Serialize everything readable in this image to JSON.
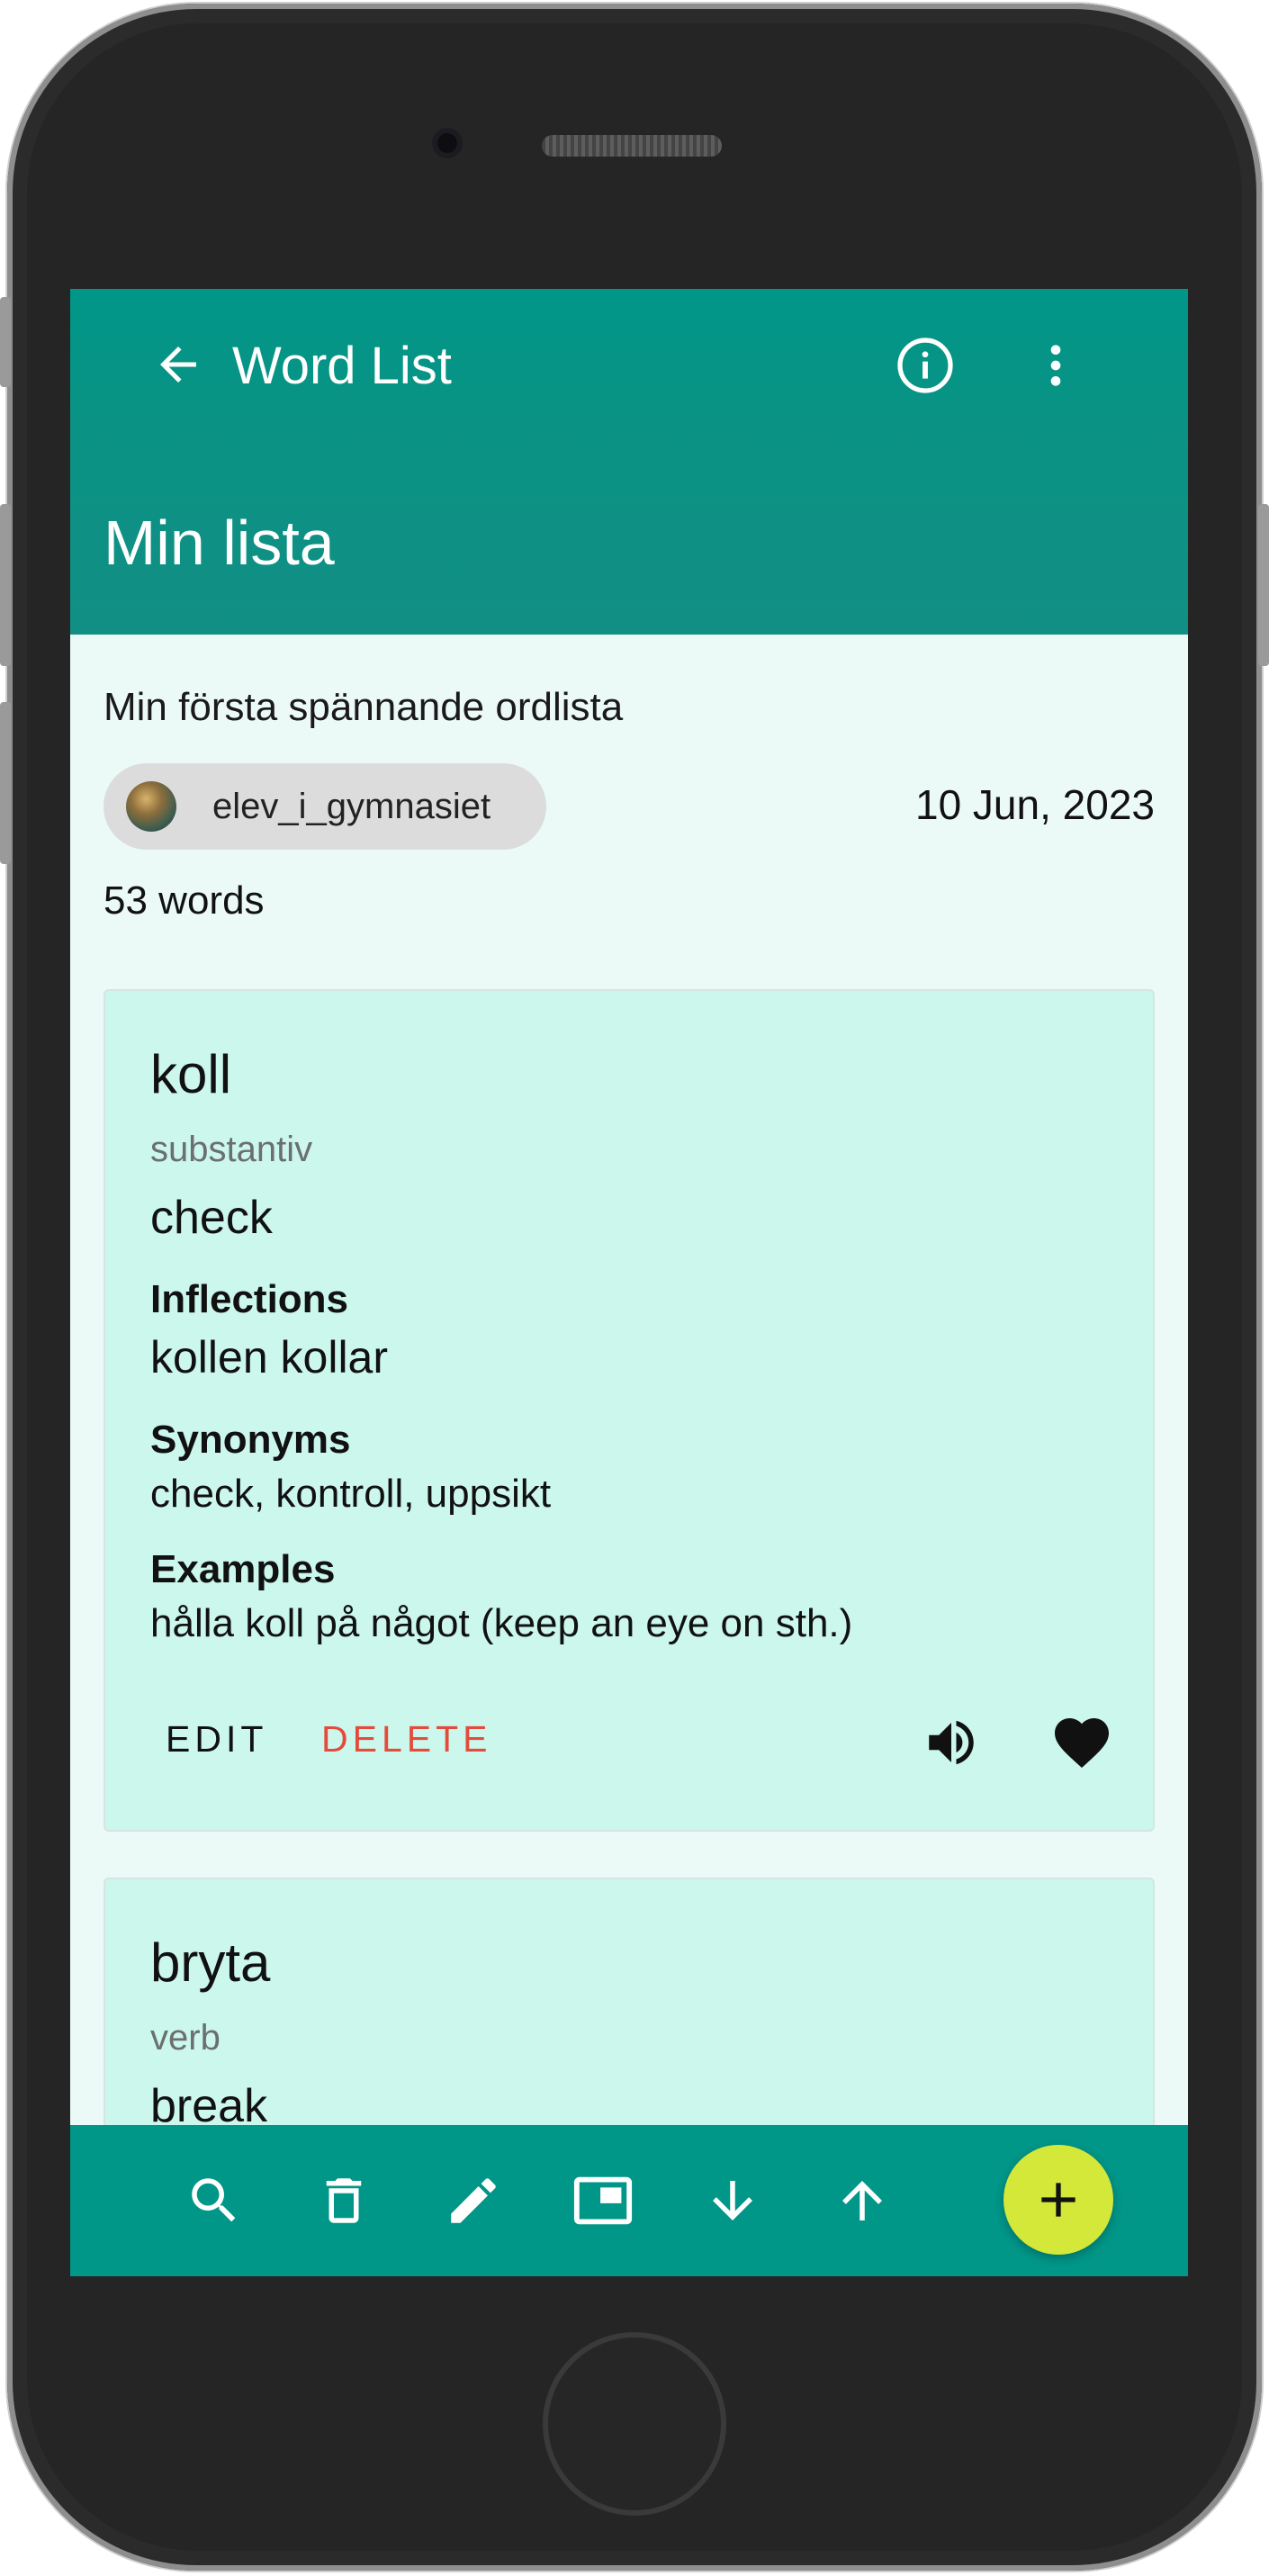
{
  "appbar": {
    "title": "Word List",
    "back_icon": "arrow-back-icon",
    "info_icon": "info-icon",
    "more_icon": "more-vert-icon"
  },
  "list": {
    "title": "Min lista",
    "description": "Min första spännande ordlista",
    "author": "elev_i_gymnasiet",
    "date": "10 Jun, 2023",
    "count": "53 words"
  },
  "words": [
    {
      "word": "koll",
      "pos": "substantiv",
      "translation": "check",
      "inflections_label": "Inflections",
      "inflections": "kollen kollar",
      "synonyms_label": "Synonyms",
      "synonyms": "check, kontroll, uppsikt",
      "examples_label": "Examples",
      "examples": "hålla koll på något (keep an eye on sth.)",
      "edit_label": "EDIT",
      "delete_label": "DELETE"
    },
    {
      "word": "bryta",
      "pos": "verb",
      "translation": "break"
    }
  ],
  "bottombar": {
    "icons": [
      "search-icon",
      "delete-icon",
      "edit-icon",
      "picture-in-picture-icon",
      "arrow-down-icon",
      "arrow-up-icon"
    ],
    "fab_icon": "add-icon"
  },
  "colors": {
    "primary": "#009688",
    "card": "#cbf7ed",
    "background": "#ecfaf7",
    "delete": "#e54b3b",
    "fab": "#d4e83a"
  }
}
